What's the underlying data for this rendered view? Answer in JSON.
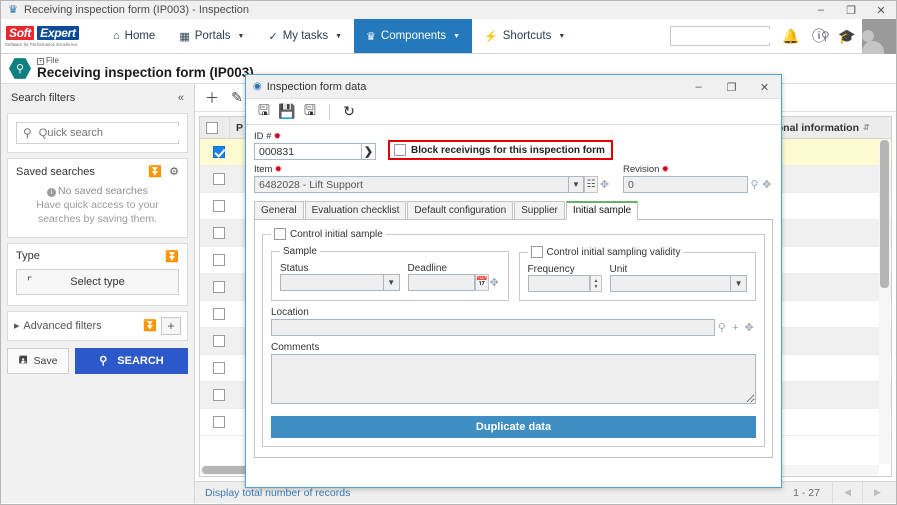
{
  "os_window": {
    "title": "Receiving inspection form (IP003) - Inspection",
    "icon": "trophy-icon",
    "minimize": "–",
    "maximize": "❐",
    "close": "✕"
  },
  "navbar": {
    "logo": {
      "soft": "Soft",
      "expert": "Expert",
      "tagline": "Software for Performance Excellence"
    },
    "items": [
      {
        "id": "home",
        "label": "Home",
        "icon": "home-icon",
        "glyph": "⌂",
        "caret": false,
        "active": false
      },
      {
        "id": "portals",
        "label": "Portals",
        "icon": "grid-icon",
        "glyph": "▦",
        "caret": true,
        "active": false
      },
      {
        "id": "my-tasks",
        "label": "My tasks",
        "icon": "check-icon",
        "glyph": "✓",
        "caret": true,
        "active": false
      },
      {
        "id": "components",
        "label": "Components",
        "icon": "trophy-icon",
        "glyph": "♛",
        "caret": true,
        "active": true
      },
      {
        "id": "shortcuts",
        "label": "Shortcuts",
        "icon": "bolt-icon",
        "glyph": "⚡",
        "caret": true,
        "active": false
      }
    ],
    "search_placeholder": "",
    "search_value": "",
    "right_icons": [
      {
        "id": "notifications",
        "name": "bell-icon",
        "glyph": "ὑ4"
      },
      {
        "id": "help",
        "name": "help-icon",
        "glyph": "?"
      },
      {
        "id": "academy",
        "name": "graduation-cap-icon",
        "glyph": "Ἱ3"
      }
    ]
  },
  "page_header": {
    "breadcrumb": "File",
    "title": "Receiving inspection form (IP003)",
    "icon": "magnifier-hex-icon"
  },
  "filters": {
    "header": "Search filters",
    "collapse_icon": "«",
    "quick_search_placeholder": "Quick search",
    "quick_search_value": "",
    "saved_searches": {
      "title": "Saved searches",
      "empty_title": "No saved searches",
      "empty_text": "Have quick access to your searches by saving them."
    },
    "type": {
      "title": "Type",
      "button_label": "Select type"
    },
    "advanced": {
      "label": "Advanced filters"
    },
    "save_label": "Save",
    "search_label": "SEARCH"
  },
  "grid": {
    "toolbar": [
      {
        "id": "add",
        "name": "plus-icon",
        "glyph": "＋"
      },
      {
        "id": "edit",
        "name": "pencil-icon",
        "glyph": "✎"
      }
    ],
    "columns": [
      {
        "id": "select",
        "label": ""
      },
      {
        "id": "p",
        "label": "P"
      },
      {
        "id": "additional-information",
        "label": "Additional information"
      }
    ],
    "rows": [
      {
        "selected": true,
        "highlight": true
      },
      {
        "selected": false,
        "highlight": false
      },
      {
        "selected": false,
        "highlight": false
      },
      {
        "selected": false,
        "highlight": false
      },
      {
        "selected": false,
        "highlight": false
      },
      {
        "selected": false,
        "highlight": false
      },
      {
        "selected": false,
        "highlight": false
      },
      {
        "selected": false,
        "highlight": false
      },
      {
        "selected": false,
        "highlight": false
      },
      {
        "selected": false,
        "highlight": false
      },
      {
        "selected": false,
        "highlight": false
      }
    ],
    "footer": {
      "display_total": "Display total number of records",
      "range": "1 - 27",
      "prev": "◀",
      "next": "▶"
    }
  },
  "modal": {
    "title": "Inspection form data",
    "title_icon": "window-icon",
    "window_buttons": {
      "minimize": "–",
      "maximize": "❐",
      "close": "✕"
    },
    "toolbar": [
      {
        "id": "save",
        "name": "save-icon",
        "glyph": "὚B"
      },
      {
        "id": "save-and-exit",
        "name": "save-exit-icon",
        "glyph": "ὋE"
      },
      {
        "id": "save-and-close",
        "name": "save-close-icon",
        "glyph": "὚B"
      },
      {
        "id": "refresh",
        "name": "refresh-icon",
        "glyph": "↻"
      }
    ],
    "fields": {
      "id_label": "ID #",
      "id_value": "000831",
      "id_arrow": "❯",
      "block_checkbox_label": "Block receivings for this inspection form",
      "block_checkbox_checked": false,
      "item_label": "Item",
      "item_value": "6482028 - Lift Support",
      "revision_label": "Revision",
      "revision_value": "0"
    },
    "tabs": [
      {
        "id": "general",
        "label": "General",
        "active": false
      },
      {
        "id": "evaluation-checklist",
        "label": "Evaluation checklist",
        "active": false
      },
      {
        "id": "default-configuration",
        "label": "Default configuration",
        "active": false
      },
      {
        "id": "supplier",
        "label": "Supplier",
        "active": false
      },
      {
        "id": "initial-sample",
        "label": "Initial sample",
        "active": true
      }
    ],
    "initial_sample": {
      "control_initial_sample_label": "Control initial sample",
      "control_initial_sample_checked": false,
      "sample_group_label": "Sample",
      "status_label": "Status",
      "status_value": "",
      "deadline_label": "Deadline",
      "deadline_value": "",
      "validity_group_label": "Control initial sampling validity",
      "validity_checked": false,
      "frequency_label": "Frequency",
      "frequency_value": "",
      "unit_label": "Unit",
      "unit_value": "",
      "location_label": "Location",
      "location_value": "",
      "comments_label": "Comments",
      "comments_value": "",
      "duplicate_button": "Duplicate data"
    }
  },
  "colors": {
    "accent_blue": "#2479bd",
    "search_button": "#2d58c9",
    "duplicate_button": "#3e8ec4",
    "highlight_row": "#fdfbd2",
    "required_red": "#d0021b",
    "alert_border": "#e60000",
    "active_tab_top": "#65b36a"
  }
}
